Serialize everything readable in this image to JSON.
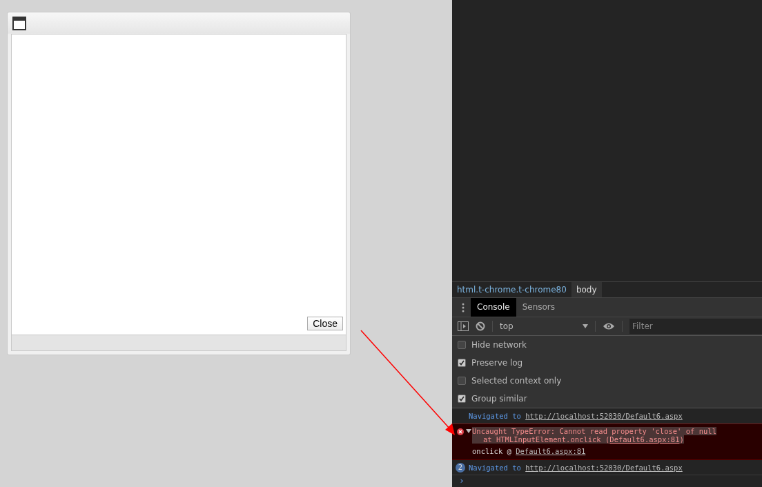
{
  "dialog": {
    "buttons": [
      "Close"
    ]
  },
  "devtools": {
    "breadcrumbs": [
      {
        "label": "html.t-chrome.t-chrome80",
        "selected": false
      },
      {
        "label": "body",
        "selected": true
      }
    ],
    "tabs": [
      {
        "label": "Console",
        "selected": true
      },
      {
        "label": "Sensors",
        "selected": false
      }
    ],
    "context": "top",
    "filter": {
      "placeholder": "Filter"
    },
    "options": [
      {
        "label": "Hide network",
        "checked": false
      },
      {
        "label": "Preserve log",
        "checked": true
      },
      {
        "label": "Selected context only",
        "checked": false
      },
      {
        "label": "Group similar",
        "checked": true
      }
    ],
    "messages": [
      {
        "kind": "info",
        "text": "Navigated to",
        "link": "http://localhost:52030/Default6.aspx"
      },
      {
        "kind": "error",
        "expanded": true,
        "text": "Uncaught TypeError: Cannot read property 'close' of null",
        "stack_text": "at HTMLInputElement.onclick (",
        "stack_link": "Default6.aspx:81",
        "stack_end": ")",
        "frame": "onclick @",
        "frame_link": "Default6.aspx:81"
      },
      {
        "kind": "info",
        "count": "2",
        "text": "Navigated to",
        "link": "http://localhost:52030/Default6.aspx"
      }
    ],
    "prompt": "›"
  }
}
